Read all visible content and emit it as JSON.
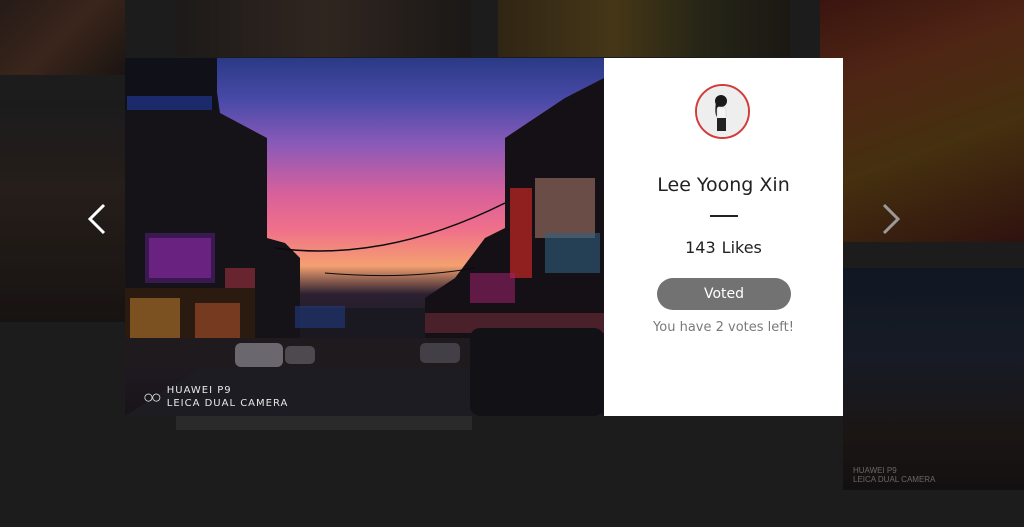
{
  "photo": {
    "camera_brand": "HUAWEI P9",
    "camera_model": "LEICA DUAL CAMERA"
  },
  "background_tiles": {
    "watermark_line1": "HUAWEI P9",
    "watermark_line2": "LEICA DUAL CAMERA"
  },
  "card": {
    "user_name": "Lee Yoong Xin",
    "likes_count": "143",
    "likes_label": "Likes",
    "vote_button_label": "Voted",
    "votes_left_text": "You have 2 votes left!"
  },
  "navigation": {
    "prev_icon": "chevron-left-icon",
    "next_icon": "chevron-right-icon"
  },
  "colors": {
    "overlay_background": "#1c1c1c",
    "card_background": "#ffffff",
    "voted_button": "#727272",
    "avatar_border": "#d33b3b",
    "secondary_text": "#7a7a7a"
  }
}
